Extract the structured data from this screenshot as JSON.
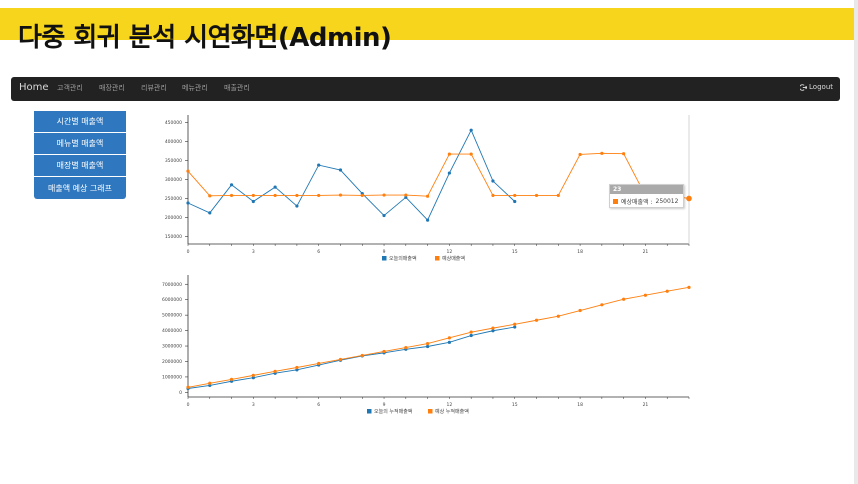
{
  "page": {
    "title": "다중 회귀 분석 시연화면(Admin)"
  },
  "navbar": {
    "brand": "Home",
    "items": [
      "고객관리",
      "매장관리",
      "리뷰관리",
      "메뉴관리",
      "매출관리"
    ],
    "logout_label": "Logout",
    "logout_icon": "logout-icon"
  },
  "sidebar": {
    "items": [
      "시간별 매출액",
      "메뉴별 매출액",
      "매장별 매출액",
      "매출액 예상 그래프"
    ]
  },
  "colors": {
    "series_actual": "#1f77b4",
    "series_predicted": "#ff7f0e",
    "navbar": "#222222",
    "sidebar": "#2f78c0",
    "title_band": "#f7d51d"
  },
  "tooltip": {
    "header": "23",
    "label": "예상매출액 : ",
    "value": "250012"
  },
  "chart_data": [
    {
      "type": "line",
      "xticks": [
        "0",
        "3",
        "6",
        "9",
        "12",
        "15",
        "18",
        "21"
      ],
      "xlim": [
        0,
        23
      ],
      "yticks": [
        "150000",
        "200000",
        "250000",
        "300000",
        "350000",
        "400000",
        "450000"
      ],
      "ylim": [
        130000,
        470000
      ],
      "series": [
        {
          "name": "오늘의매출액",
          "values": [
            238000,
            212000,
            286000,
            242000,
            280000,
            230000,
            338000,
            325000,
            263000,
            205000,
            253000,
            193000,
            317000,
            430000,
            296000,
            242000
          ]
        },
        {
          "name": "예상매출액",
          "values": [
            322000,
            257000,
            258000,
            258000,
            258000,
            258000,
            258000,
            259000,
            258000,
            259000,
            259000,
            256000,
            367000,
            367000,
            258000,
            258000,
            258000,
            258000,
            366000,
            369000,
            368000,
            258000,
            258000,
            250012
          ]
        }
      ]
    },
    {
      "type": "line",
      "xticks": [
        "0",
        "3",
        "6",
        "9",
        "12",
        "15",
        "18",
        "21"
      ],
      "xlim": [
        0,
        23
      ],
      "yticks": [
        "0",
        "1000000",
        "2000000",
        "3000000",
        "4000000",
        "5000000",
        "6000000",
        "7000000"
      ],
      "ylim": [
        -300000,
        7600000
      ],
      "series": [
        {
          "name": "오늘의 누적매출액",
          "values": [
            250000,
            450000,
            720000,
            950000,
            1240000,
            1460000,
            1770000,
            2080000,
            2360000,
            2560000,
            2790000,
            2970000,
            3240000,
            3680000,
            3990000,
            4230000
          ]
        },
        {
          "name": "예상 누적매출액",
          "values": [
            330000,
            590000,
            840000,
            1100000,
            1360000,
            1610000,
            1870000,
            2130000,
            2390000,
            2650000,
            2900000,
            3160000,
            3530000,
            3900000,
            4160000,
            4410000,
            4670000,
            4930000,
            5300000,
            5670000,
            6030000,
            6290000,
            6550000,
            6800000
          ]
        }
      ]
    }
  ]
}
